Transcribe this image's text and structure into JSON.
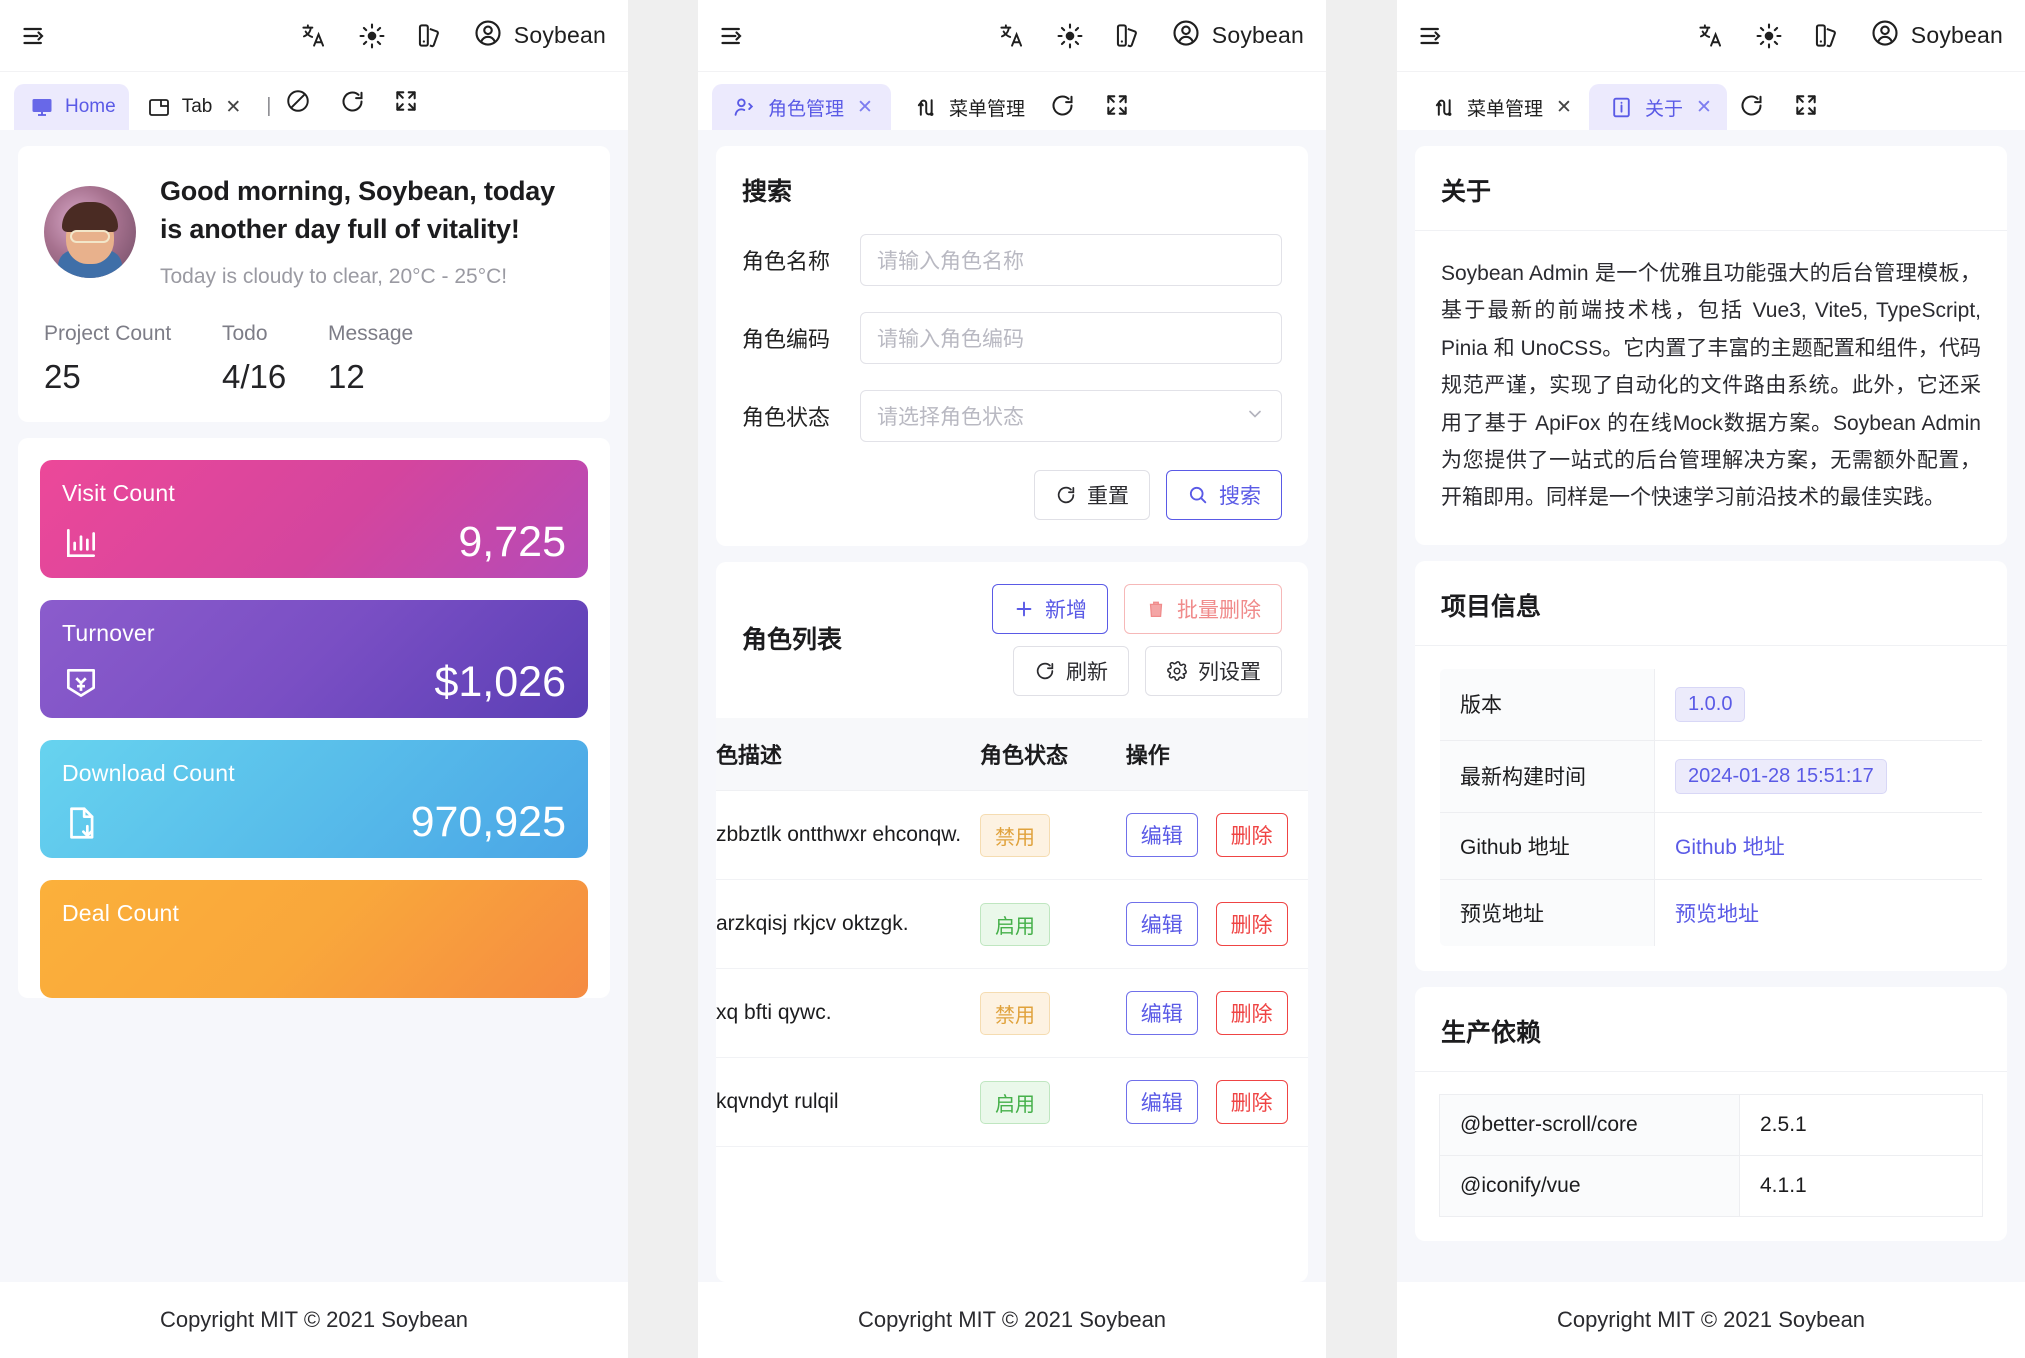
{
  "header": {
    "user_name": "Soybean",
    "icons": {
      "menu_collapse": "menu-collapse-icon",
      "language": "language-icon",
      "theme": "sun-icon",
      "palette": "palette-icon",
      "avatar": "user-circle-icon"
    }
  },
  "panel1": {
    "tabs": [
      {
        "label": "Home",
        "icon": "monitor-icon",
        "active": true,
        "closable": false
      },
      {
        "label": "Tab",
        "icon": "window-icon",
        "active": false,
        "closable": true
      }
    ],
    "tab_actions": {
      "disabled": "no-entry-icon",
      "reload": "reload-icon",
      "fullscreen": "fullscreen-icon"
    },
    "greeting": {
      "title": "Good morning, Soybean, today is another day full of vitality!",
      "weather": "Today is cloudy to clear, 20°C - 25°C!"
    },
    "stats": [
      {
        "label": "Project Count",
        "value": "25"
      },
      {
        "label": "Todo",
        "value": "4/16"
      },
      {
        "label": "Message",
        "value": "12"
      }
    ],
    "cards": [
      {
        "title": "Visit Count",
        "value": "9,725",
        "icon": "bar-chart-icon",
        "color": "#ec4899"
      },
      {
        "title": "Turnover",
        "value": "$1,026",
        "icon": "money-icon",
        "color": "#8b5ccc"
      },
      {
        "title": "Download Count",
        "value": "970,925",
        "icon": "download-file-icon",
        "color": "#67d3ef"
      },
      {
        "title": "Deal Count",
        "value": "",
        "icon": "",
        "color": "#fbb03b"
      }
    ]
  },
  "panel2": {
    "tabs": [
      {
        "label": "角色管理",
        "icon": "user-role-icon",
        "active": true,
        "closable": true
      },
      {
        "label": "菜单管理",
        "icon": "menu-tree-icon",
        "active": false,
        "closable": false
      }
    ],
    "tab_actions": {
      "reload": "reload-icon",
      "fullscreen": "fullscreen-icon"
    },
    "search": {
      "title": "搜索",
      "fields": [
        {
          "label": "角色名称",
          "placeholder": "请输入角色名称",
          "value": "",
          "type": "text"
        },
        {
          "label": "角色编码",
          "placeholder": "请输入角色编码",
          "value": "",
          "type": "text"
        },
        {
          "label": "角色状态",
          "placeholder": "请选择角色状态",
          "value": "",
          "type": "select"
        }
      ],
      "reset_label": "重置",
      "search_label": "搜索"
    },
    "list": {
      "title": "角色列表",
      "add_label": "新增",
      "batch_delete_label": "批量删除",
      "refresh_label": "刷新",
      "column_setting_label": "列设置",
      "columns": [
        "色描述",
        "角色状态",
        "操作"
      ],
      "rows": [
        {
          "desc": "zbbztlk ontthwxr ehconqw.",
          "status": "禁用",
          "status_type": "off",
          "edit": "编辑",
          "delete": "删除"
        },
        {
          "desc": "arzkqisj rkjcv oktzgk.",
          "status": "启用",
          "status_type": "on",
          "edit": "编辑",
          "delete": "删除"
        },
        {
          "desc": "xq bfti qywc.",
          "status": "禁用",
          "status_type": "off",
          "edit": "编辑",
          "delete": "删除"
        },
        {
          "desc": "kqvndyt rulqil",
          "status": "启用",
          "status_type": "on",
          "edit": "编辑",
          "delete": "删除"
        }
      ]
    }
  },
  "panel3": {
    "tabs": [
      {
        "label": "菜单管理",
        "icon": "menu-tree-icon",
        "active": false,
        "closable": true
      },
      {
        "label": "关于",
        "icon": "info-icon",
        "active": true,
        "closable": true
      }
    ],
    "tab_actions": {
      "reload": "reload-icon",
      "fullscreen": "fullscreen-icon"
    },
    "about": {
      "title": "关于",
      "description": "Soybean Admin 是一个优雅且功能强大的后台管理模板，基于最新的前端技术栈，包括 Vue3, Vite5, TypeScript, Pinia 和 UnoCSS。它内置了丰富的主题配置和组件，代码规范严谨，实现了自动化的文件路由系统。此外，它还采用了基于 ApiFox 的在线Mock数据方案。Soybean Admin 为您提供了一站式的后台管理解决方案，无需额外配置，开箱即用。同样是一个快速学习前沿技术的最佳实践。"
    },
    "project_info": {
      "title": "项目信息",
      "rows": [
        {
          "key": "版本",
          "value": "1.0.0",
          "style": "tag"
        },
        {
          "key": "最新构建时间",
          "value": "2024-01-28 15:51:17",
          "style": "tag"
        },
        {
          "key": "Github 地址",
          "value": "Github 地址",
          "style": "link"
        },
        {
          "key": "预览地址",
          "value": "预览地址",
          "style": "link"
        }
      ]
    },
    "dependencies": {
      "title": "生产依赖",
      "rows": [
        {
          "name": "@better-scroll/core",
          "version": "2.5.1"
        },
        {
          "name": "@iconify/vue",
          "version": "4.1.1"
        }
      ]
    }
  },
  "footer": {
    "text": "Copyright MIT © 2021 Soybean"
  },
  "colors": {
    "accent": "#5a5ae6",
    "tab_active_bg": "#eceafd",
    "success": "#46b04a",
    "warning": "#e0a23c",
    "danger": "#ef4444",
    "page_bg": "#f6f7fb"
  }
}
